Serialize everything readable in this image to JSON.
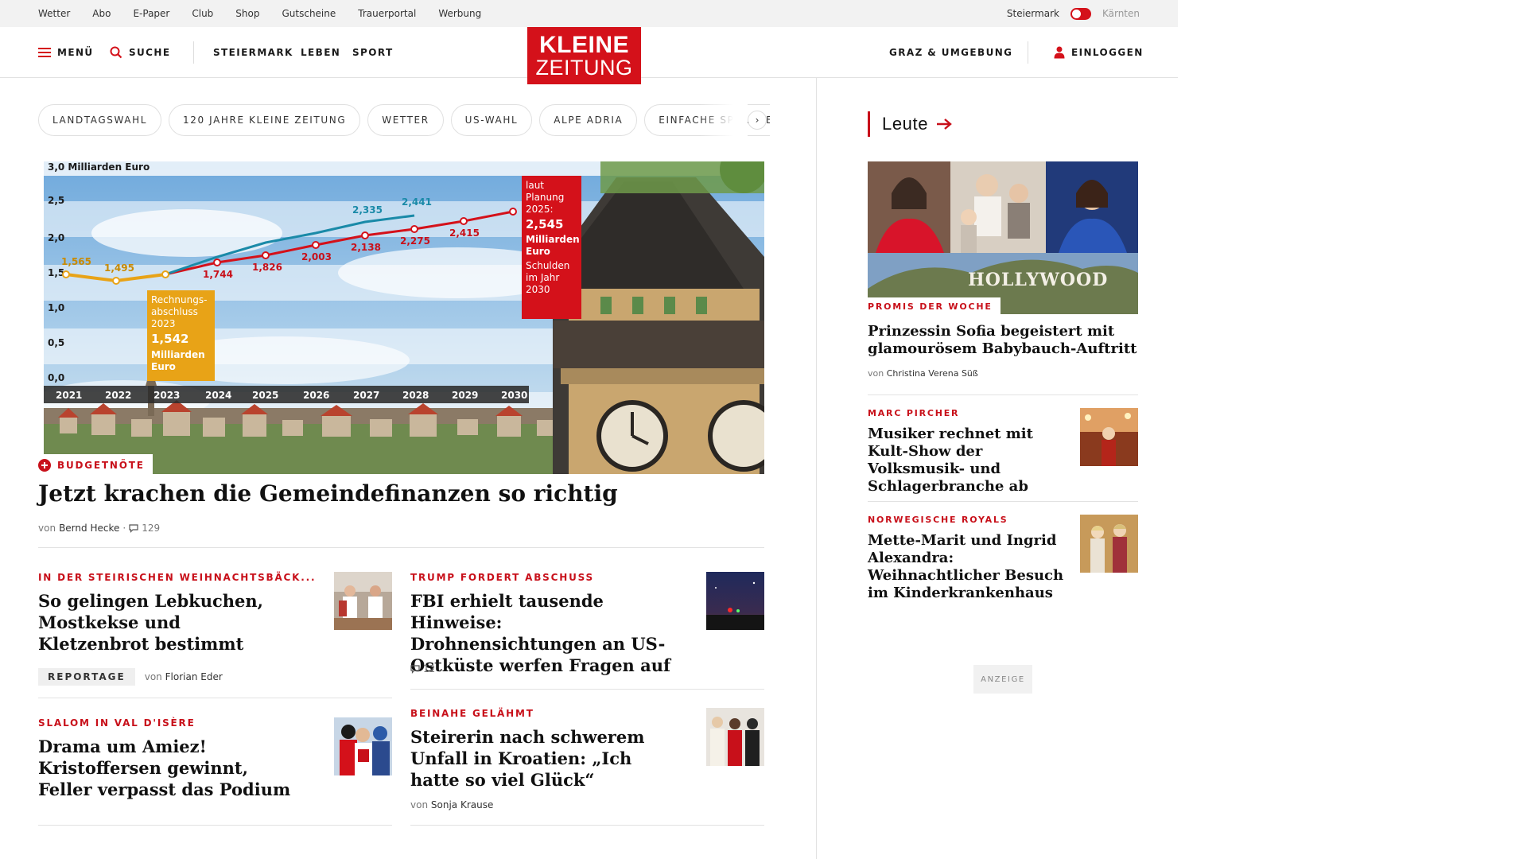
{
  "utility": {
    "links": [
      "Wetter",
      "Abo",
      "E-Paper",
      "Club",
      "Shop",
      "Gutscheine",
      "Trauerportal",
      "Werbung"
    ],
    "region_active": "Steiermark",
    "region_inactive": "Kärnten"
  },
  "header": {
    "menu_label": "MENÜ",
    "search_label": "SUCHE",
    "nav": [
      "STEIERMARK",
      "LEBEN",
      "SPORT"
    ],
    "logo_line1": "KLEINE",
    "logo_line2": "ZEITUNG",
    "region_link": "GRAZ & UMGEBUNG",
    "login_label": "EINLOGGEN"
  },
  "topics": [
    "LANDTAGSWAHL",
    "120 JAHRE KLEINE ZEITUNG",
    "WETTER",
    "US-WAHL",
    "ALPE ADRIA",
    "EINFACHE SPRACHE"
  ],
  "hero": {
    "kicker": "BUDGETNÖTE",
    "title": "Jetzt krachen die Gemeindefinanzen so richtig",
    "by_prefix": "von",
    "author": "Bernd Hecke",
    "comments": "129"
  },
  "hero_chart": {
    "unit_label": "3,0 Milliarden Euro",
    "y_ticks": [
      "2,5",
      "2,0",
      "1,5",
      "1,0",
      "0,5",
      "0,0"
    ],
    "years": [
      "2021",
      "2022",
      "2023",
      "2024",
      "2025",
      "2026",
      "2027",
      "2028",
      "2029",
      "2030"
    ],
    "actual_labels": [
      "1,565",
      "1,495"
    ],
    "plan_labels": [
      "1,744",
      "1,826",
      "2,003",
      "2,138",
      "2,275",
      "2,415"
    ],
    "upper_labels": [
      "2,335",
      "2,441"
    ],
    "box_orange": [
      "Rechnungs-",
      "abschluss",
      "2023",
      "1,542",
      "Milliarden",
      "Euro"
    ],
    "box_red": [
      "laut",
      "Planung",
      "2025:",
      "2,545",
      "Milliarden",
      "Euro",
      "Schulden",
      "im Jahr",
      "2030"
    ]
  },
  "teasers": [
    {
      "kicker": "IN DER STEIRISCHEN WEIHNACHTSBÄCK...",
      "title": "So gelingen Lebkuchen, Mostkekse und Kletzenbrot bestimmt",
      "tag": "REPORTAGE",
      "by_prefix": "von",
      "author": "Florian Eder"
    },
    {
      "kicker": "TRUMP FORDERT ABSCHUSS",
      "title": "FBI erhielt tausende Hinweise: Drohnensichtungen an US-Ostküste werfen Fragen auf",
      "comments": "12"
    },
    {
      "kicker": "SLALOM IN VAL D'ISÈRE",
      "title": "Drama um Amiez! Kristoffersen gewinnt, Feller verpasst das Podium"
    },
    {
      "kicker": "BEINAHE GELÄHMT",
      "title": "Steirerin nach schwerem Unfall in Kroatien: „Ich hatte so viel Glück“",
      "by_prefix": "von",
      "author": "Sonja Krause"
    }
  ],
  "sidebar": {
    "heading": "Leute",
    "lead": {
      "image_text": "HOLLYWOOD",
      "kicker": "PROMIS DER WOCHE",
      "title": "Prinzessin Sofia begeistert mit glamourösem Babybauch-Auftritt",
      "by_prefix": "von",
      "author": "Christina Verena Süß"
    },
    "items": [
      {
        "kicker": "MARC PIRCHER",
        "title": "Musiker rechnet mit Kult-Show der Volksmusik- und Schlagerbranche ab"
      },
      {
        "kicker": "NORWEGISCHE ROYALS",
        "title": "Mette-Marit und Ingrid Alexandra: Weihnachtlicher Besuch im Kinderkrankenhaus"
      }
    ],
    "ad_label": "ANZEIGE"
  }
}
